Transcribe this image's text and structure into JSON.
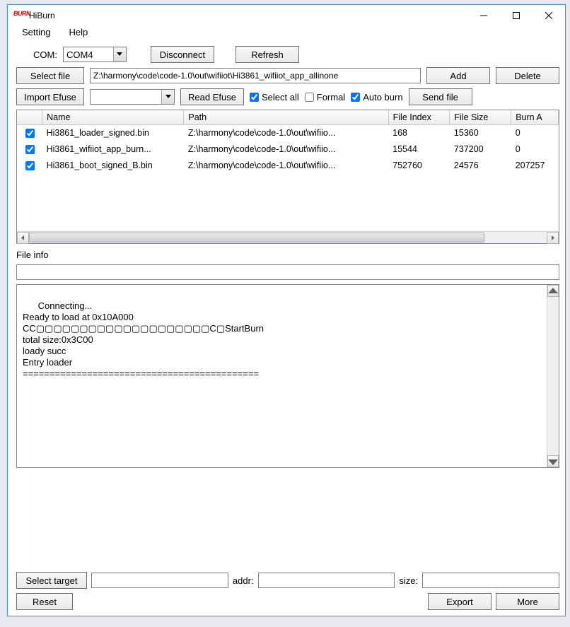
{
  "app": {
    "icon_text": "BURN",
    "title": "HiBurn"
  },
  "menubar": {
    "setting": "Setting",
    "help": "Help"
  },
  "comRow": {
    "label": "COM:",
    "value": "COM4",
    "disconnect": "Disconnect",
    "refresh": "Refresh"
  },
  "fileRow": {
    "select_file": "Select file",
    "path": "Z:\\harmony\\code\\code-1.0\\out\\wifiiot\\Hi3861_wifiiot_app_allinone",
    "add": "Add",
    "delete": "Delete"
  },
  "efuseRow": {
    "import_efuse": "Import Efuse",
    "dropdown_value": "",
    "read_efuse": "Read Efuse",
    "select_all_label": "Select all",
    "select_all_checked": true,
    "formal_label": "Formal",
    "formal_checked": false,
    "auto_burn_label": "Auto burn",
    "auto_burn_checked": true,
    "send_file": "Send file"
  },
  "table": {
    "headers": {
      "name": "Name",
      "path": "Path",
      "file_index": "File Index",
      "file_size": "File Size",
      "burn_addr": "Burn A"
    },
    "rows": [
      {
        "checked": true,
        "name": "Hi3861_loader_signed.bin",
        "path": "Z:\\harmony\\code\\code-1.0\\out\\wifiio...",
        "index": "168",
        "size": "15360",
        "burn": "0"
      },
      {
        "checked": true,
        "name": "Hi3861_wifiiot_app_burn...",
        "path": "Z:\\harmony\\code\\code-1.0\\out\\wifiio...",
        "index": "15544",
        "size": "737200",
        "burn": "0"
      },
      {
        "checked": true,
        "name": "Hi3861_boot_signed_B.bin",
        "path": "Z:\\harmony\\code\\code-1.0\\out\\wifiio...",
        "index": "752760",
        "size": "24576",
        "burn": "207257"
      }
    ]
  },
  "fileInfo": {
    "label": "File info"
  },
  "log": {
    "text": "Connecting...\nReady to load at 0x10A000\nCC▢▢▢▢▢▢▢▢▢▢▢▢▢▢▢▢▢▢▢▢C▢StartBurn\ntotal size:0x3C00\nloady succ\nEntry loader\n============================================"
  },
  "bottom": {
    "select_target": "Select target",
    "target_value": "",
    "addr_label": "addr:",
    "addr_value": "",
    "size_label": "size:",
    "size_value": "",
    "reset": "Reset",
    "export": "Export",
    "more": "More"
  }
}
